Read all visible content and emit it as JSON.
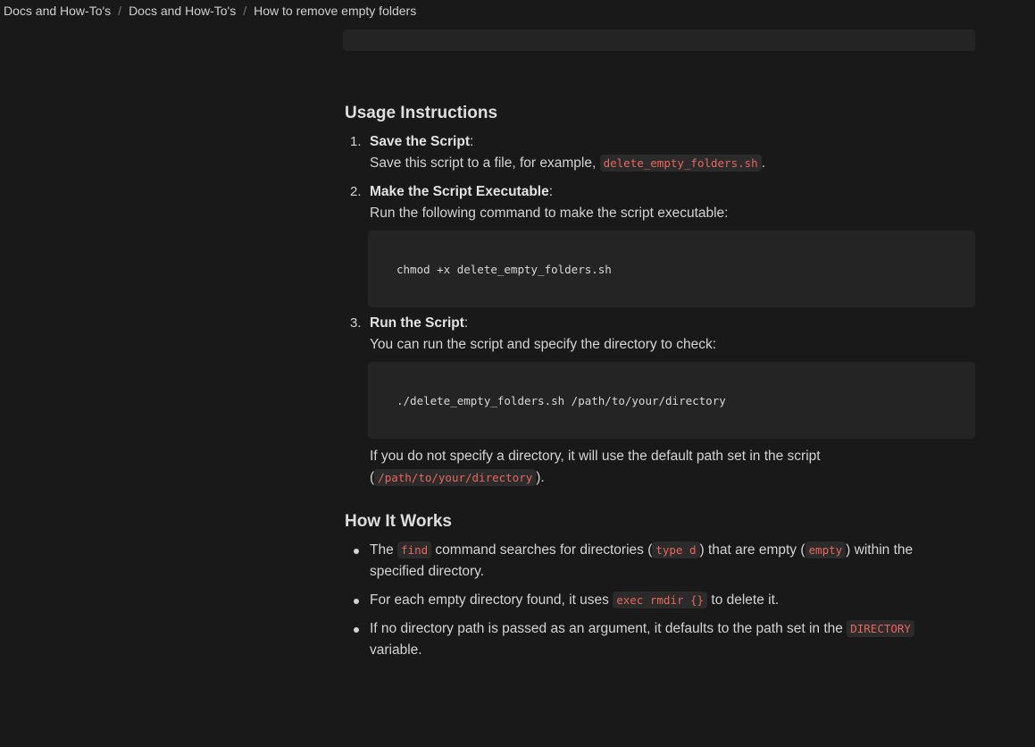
{
  "breadcrumb": {
    "items": [
      "Docs and How-To's",
      "Docs and How-To's",
      "How to remove empty folders"
    ],
    "separator": "/"
  },
  "usage": {
    "heading": "Usage Instructions",
    "steps": [
      {
        "number": "1.",
        "title": "Save the Script",
        "colon": ":",
        "text_before": "Save this script to a file, for example, ",
        "code": "delete_empty_folders.sh",
        "text_after": "."
      },
      {
        "number": "2.",
        "title": "Make the Script Executable",
        "colon": ":",
        "text": "Run the following command to make the script executable:",
        "code_block": "chmod +x delete_empty_folders.sh"
      },
      {
        "number": "3.",
        "title": "Run the Script",
        "colon": ":",
        "text": "You can run the script and specify the directory to check:",
        "code_block": "./delete_empty_folders.sh /path/to/your/directory",
        "note_before": "If you do not specify a directory, it will use the default path set in the script (",
        "note_code": "/path/to/your/directory",
        "note_after": ")."
      }
    ]
  },
  "how_it_works": {
    "heading": "How It Works",
    "bullets": [
      {
        "t1": "The ",
        "c1": "find",
        "t2": " command searches for directories (",
        "c2": "type d",
        "t3": ") that are empty (",
        "c3": "empty",
        "t4": ") within the specified directory."
      },
      {
        "t1": "For each empty directory found, it uses ",
        "c1": "exec rmdir {}",
        "t2": " to delete it."
      },
      {
        "t1": "If no directory path is passed as an argument, it defaults to the path set in the ",
        "c1": "DIRECTORY",
        "t2": " variable."
      }
    ]
  },
  "colors": {
    "background": "#191919",
    "code_background": "#242424",
    "inline_code_text": "#e8665d"
  }
}
